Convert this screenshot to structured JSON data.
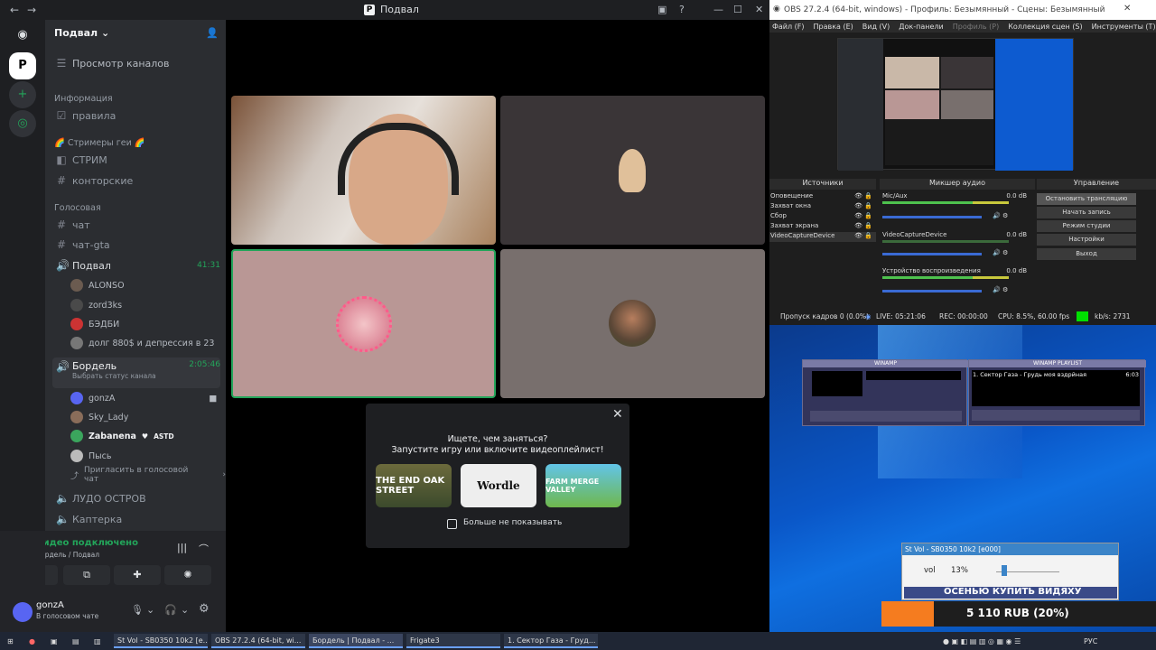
{
  "discord": {
    "window_title": "Подвал",
    "server_name": "Подвал",
    "browse_channels": "Просмотр каналов",
    "categories": [
      {
        "name": "Информация"
      },
      {
        "name": "🌈 Стримеры геи 🌈"
      },
      {
        "name": "Голосовая"
      }
    ],
    "info_channels": [
      {
        "label": "правила"
      }
    ],
    "stream_channels": [
      {
        "label": "СТРИМ"
      },
      {
        "label": "конторские"
      }
    ],
    "text_channels": [
      {
        "label": "чат"
      },
      {
        "label": "чат-gta"
      }
    ],
    "voice1": {
      "label": "Подвал",
      "timer": "41:31",
      "users": [
        {
          "name": "ALONSO"
        },
        {
          "name": "zord3ks"
        },
        {
          "name": "БЭДБИ"
        },
        {
          "name": "долг 880$ и депрессия в 23"
        }
      ]
    },
    "voice2": {
      "label": "Бордель",
      "timer": "2:05:46",
      "status": "Выбрать статус канала",
      "users": [
        {
          "name": "gonzA"
        },
        {
          "name": "Sky_Lady"
        },
        {
          "name": "Zabanena",
          "tag": "ASTD"
        },
        {
          "name": "Пысь"
        }
      ],
      "invite": "Пригласить в голосовой чат"
    },
    "other_voice": [
      {
        "label": "ЛУДО ОСТРОВ"
      },
      {
        "label": "Каптерка"
      }
    ],
    "connection": {
      "title": "Видео подключено",
      "sub": "Бордель / Подвал"
    },
    "user": {
      "name": "gonzA",
      "status": "В голосовом чате"
    },
    "popup": {
      "title": "Ищете, чем заняться?",
      "subtitle": "Запустите игру или включите видеоплейлист!",
      "games": [
        "THE END OAK STREET",
        "Wordle",
        "FARM MERGE VALLEY"
      ],
      "checkbox_label": "Больше не показывать"
    }
  },
  "obs": {
    "title": "OBS 27.2.4 (64-bit, windows) - Профиль: Безымянный - Сцены: Безымянный",
    "menu": [
      "Файл (F)",
      "Правка (E)",
      "Вид (V)",
      "Док-панели",
      "Профиль (P)",
      "Коллекция сцен (S)",
      "Инструменты (T)"
    ],
    "panels": {
      "sources": "Источники",
      "mixer": "Микшер аудио",
      "controls": "Управление"
    },
    "sources": [
      "Оповещение",
      "Захват окна",
      "Сбор",
      "Захват экрана",
      "VideoCaptureDevice"
    ],
    "mixer": [
      {
        "name": "Mic/Aux",
        "db": "0.0 dB"
      },
      {
        "name": "VideoCaptureDevice",
        "db": "0.0 dB"
      },
      {
        "name": "Устройство воспроизведения",
        "db": "0.0 dB"
      }
    ],
    "controls": [
      "Остановить трансляцию",
      "Начать запись",
      "Режим студии",
      "Настройки",
      "Выход"
    ],
    "status": {
      "dropped": "Пропуск кадров 0 (0.0%)",
      "live": "LIVE: 05:21:06",
      "rec": "REC: 00:00:00",
      "cpu": "CPU: 8.5%, 60.00 fps",
      "kbs": "kb/s: 2731"
    },
    "colors": {
      "meter_green": "#4ec24e",
      "meter_yellow": "#c8c83c",
      "bitrate_green": "#00e000"
    }
  },
  "winamp": {
    "main_title": "WINAMP",
    "playlist_title": "WINAMP PLAYLIST",
    "track": "1. Сектор Газа - Грудь моя вздрйная",
    "time": "6:03"
  },
  "stvol": {
    "title": "St Vol - SB0350 10k2 [e000]",
    "label": "vol",
    "value": "13%",
    "level": 0.13
  },
  "donation": {
    "banner": "ОСЕНЬЮ КУПИТЬ ВИДЯХУ",
    "amount": "5 110 RUB (20%)",
    "progress": 0.2
  },
  "taskbar": {
    "apps": [
      "St Vol - SB0350 10k2 [e...",
      "OBS 27.2.4 (64-bit, wi...",
      "Бордель | Подвал - ...",
      "Frigate3",
      "1. Сектор Газа - Груд..."
    ],
    "lang": "РУС"
  }
}
